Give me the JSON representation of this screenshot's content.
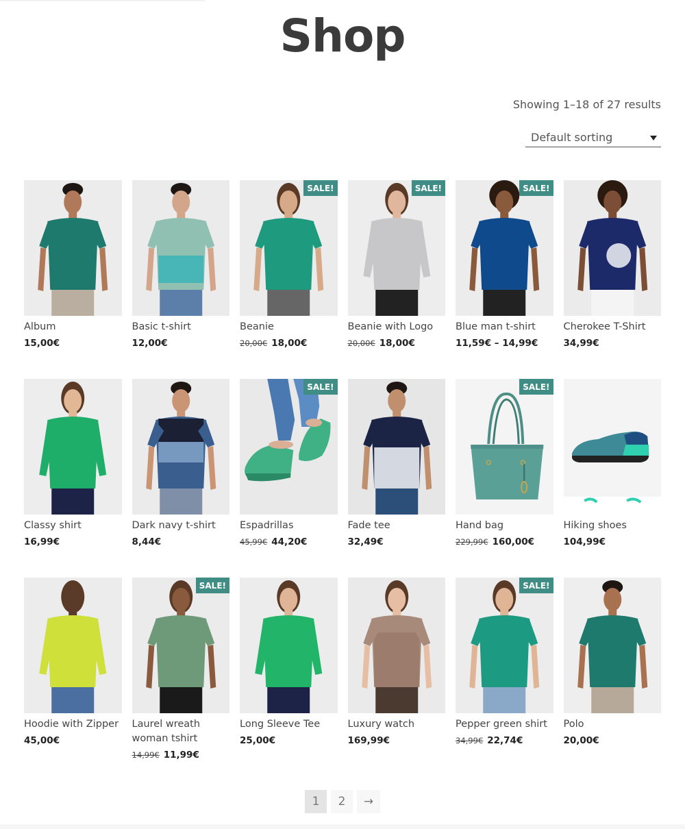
{
  "page": {
    "title": "Shop",
    "result_count": "Showing 1–18 of 27 results",
    "sorting": {
      "selected": "Default sorting",
      "icon": "caret-down-icon"
    },
    "sale_badge": "SALE!",
    "colors": {
      "sale_badge": "#3f8d85",
      "title": "#3b3b3b",
      "current_page_bg": "#e4e4e4",
      "page_bg": "#f7f7f7"
    }
  },
  "products": [
    {
      "name": "Album",
      "price": "15,00€",
      "old_price": null,
      "sale": false,
      "image": "man-teal-polo",
      "bg": "#ececec",
      "shirt": "#1f7a6e",
      "skin": "#b07a5a",
      "pants": "#b9aea0"
    },
    {
      "name": "Basic t-shirt",
      "price": "12,00€",
      "old_price": null,
      "sale": false,
      "image": "man-gradient-tee",
      "bg": "#ebebeb",
      "shirt": "#8fc0b2",
      "skin": "#d3a58a",
      "pants": "#5b7fa8"
    },
    {
      "name": "Beanie",
      "price": "18,00€",
      "old_price": "20,00€",
      "sale": true,
      "image": "woman-green-top",
      "bg": "#ebebeb",
      "shirt": "#1e9a7f",
      "skin": "#d6a988",
      "pants": "#666666"
    },
    {
      "name": "Beanie with Logo",
      "price": "18,00€",
      "old_price": "20,00€",
      "sale": true,
      "image": "woman-grey-sweater",
      "bg": "#ededed",
      "shirt": "#c7c7c9",
      "skin": "#e0b79c",
      "pants": "#222222"
    },
    {
      "name": "Blue man t-shirt",
      "price": "11,59€ – 14,99€",
      "old_price": null,
      "sale": true,
      "image": "man-blue-tee",
      "bg": "#ececec",
      "shirt": "#0e4a8c",
      "skin": "#8a5a3c",
      "pants": "#222222"
    },
    {
      "name": "Cherokee T-Shirt",
      "price": "34,99€",
      "old_price": null,
      "sale": false,
      "image": "woman-navy-print-tee",
      "bg": "#ebebeb",
      "shirt": "#1c2a6a",
      "skin": "#7b4e35",
      "pants": "#f4f4f4"
    },
    {
      "name": "Classy shirt",
      "price": "16,99€",
      "old_price": null,
      "sale": false,
      "image": "woman-green-blouse",
      "bg": "#ededed",
      "shirt": "#1fae6a",
      "skin": "#e2b796",
      "pants": "#1d2247"
    },
    {
      "name": "Dark navy t-shirt",
      "price": "8,44€",
      "old_price": null,
      "sale": false,
      "image": "man-colorblock-tee",
      "bg": "#ebebeb",
      "shirt": "#3a5f8f",
      "skin": "#c99574",
      "pants": "#7e8fa7"
    },
    {
      "name": "Espadrillas",
      "price": "44,20€",
      "old_price": "45,99€",
      "sale": true,
      "image": "green-espadrilles",
      "bg": "#e9e9e9",
      "shirt": "#4a78b0",
      "skin": "#d9b095",
      "pants": "#3fb184"
    },
    {
      "name": "Fade tee",
      "price": "32,49€",
      "old_price": null,
      "sale": false,
      "image": "man-fade-tee",
      "bg": "#e6e6e6",
      "shirt": "#1c2446",
      "skin": "#c0906e",
      "pants": "#2c4f7a"
    },
    {
      "name": "Hand bag",
      "price": "160,00€",
      "old_price": "229,99€",
      "sale": true,
      "image": "teal-handbag",
      "bg": "#f4f4f4",
      "shirt": "#5aa096",
      "skin": "#c8a64a",
      "pants": "#f4f4f4"
    },
    {
      "name": "Hiking shoes",
      "price": "104,99€",
      "old_price": null,
      "sale": false,
      "image": "teal-hiking-shoe",
      "bg": "#f4f4f4",
      "shirt": "#3e8a96",
      "skin": "#2fd0b0",
      "pants": "#222222"
    },
    {
      "name": "Hoodie with Zipper",
      "price": "45,00€",
      "old_price": null,
      "sale": false,
      "image": "woman-yellow-top",
      "bg": "#ececec",
      "shirt": "#cfe03a",
      "skin": "#5a3a28",
      "pants": "#4a6fa0"
    },
    {
      "name": "Laurel wreath woman tshirt",
      "price": "11,99€",
      "old_price": "14,99€",
      "sale": true,
      "image": "woman-sage-tee",
      "bg": "#ebebeb",
      "shirt": "#6f9a7a",
      "skin": "#8a5a3e",
      "pants": "#1a1a1a"
    },
    {
      "name": "Long Sleeve Tee",
      "price": "25,00€",
      "old_price": null,
      "sale": false,
      "image": "woman-green-longsleeve",
      "bg": "#ececec",
      "shirt": "#22b56a",
      "skin": "#e0b496",
      "pants": "#1d2247"
    },
    {
      "name": "Luxury watch",
      "price": "169,99€",
      "old_price": null,
      "sale": false,
      "image": "woman-snake-print",
      "bg": "#eaeaea",
      "shirt": "#a88a7a",
      "skin": "#e6bea3",
      "pants": "#4a3a30"
    },
    {
      "name": "Pepper green shirt",
      "price": "22,74€",
      "old_price": "34,99€",
      "sale": true,
      "image": "woman-green-floral",
      "bg": "#ececec",
      "shirt": "#1d9b82",
      "skin": "#e0b596",
      "pants": "#8aa8c8"
    },
    {
      "name": "Polo",
      "price": "20,00€",
      "old_price": null,
      "sale": false,
      "image": "man-teal-polo-2",
      "bg": "#eeeeee",
      "shirt": "#1f7a6e",
      "skin": "#a8714f",
      "pants": "#b7a99a"
    }
  ],
  "pagination": {
    "pages": [
      "1",
      "2"
    ],
    "current": "1",
    "next_label": "→"
  }
}
